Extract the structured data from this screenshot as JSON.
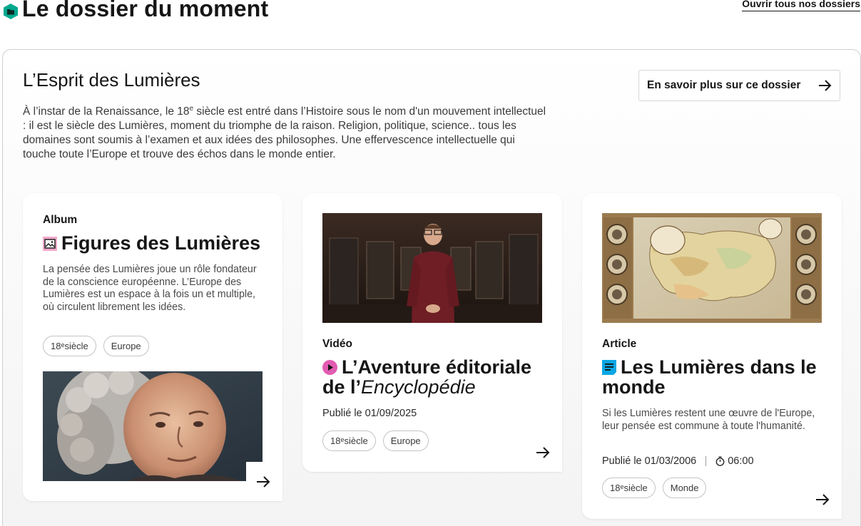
{
  "header": {
    "title": "Le dossier du moment",
    "open_all_label": "Ouvrir tous nos dossiers"
  },
  "dossier": {
    "title": "L’Esprit des Lumières",
    "more_label": "En savoir plus sur ce dossier",
    "desc_pre": "À l’instar de la Renaissance, le 18",
    "desc_sup": "e",
    "desc_post": " siècle est entré dans l’Histoire sous le nom d'un mouvement intellectuel : il est le siècle des Lumières, moment du triomphe de la raison. Religion, politique, science.. tous les domaines sont soumis à l’examen et aux idées des philosophes. Une effervescence intellectuelle qui touche toute l’Europe et trouve des échos dans le monde entier."
  },
  "cards": [
    {
      "type": "Album",
      "icon": "album-icon",
      "title": "Figures des Lumières",
      "desc": "La pensée des Lumières joue un rôle fondateur de la conscience européenne. L’Europe des Lumières est un espace à la fois un et multiple, où circulent librement les idées.",
      "tags": [
        {
          "num": "18",
          "sup": "e",
          "rest": " siècle"
        },
        {
          "text": "Europe"
        }
      ],
      "image": "portrait-painting"
    },
    {
      "type": "Vidéo",
      "icon": "video-play-icon",
      "title_pre": "L’Aventure éditoriale de l’",
      "title_em": "Encyclopédie",
      "published": "Publié le 01/09/2025",
      "tags": [
        {
          "num": "18",
          "sup": "e",
          "rest": " siècle"
        },
        {
          "text": "Europe"
        }
      ],
      "image": "video-still-presenter"
    },
    {
      "type": "Article",
      "icon": "article-icon",
      "title": "Les Lumières dans le monde",
      "desc": "Si les Lumières restent une œuvre de l'Europe, leur pensée est commune à toute l'humanité.",
      "published": "Publié le 01/03/2006",
      "reading_time": "06:00",
      "tags": [
        {
          "num": "18",
          "sup": "e",
          "rest": " siècle"
        },
        {
          "text": "Monde"
        }
      ],
      "image": "antique-map-europe"
    }
  ],
  "colors": {
    "brand_green": "#00a88f",
    "album_pink": "#e6559b",
    "video_pink": "#e25cb2",
    "article_blue": "#0aa7e4",
    "text": "#161616"
  }
}
